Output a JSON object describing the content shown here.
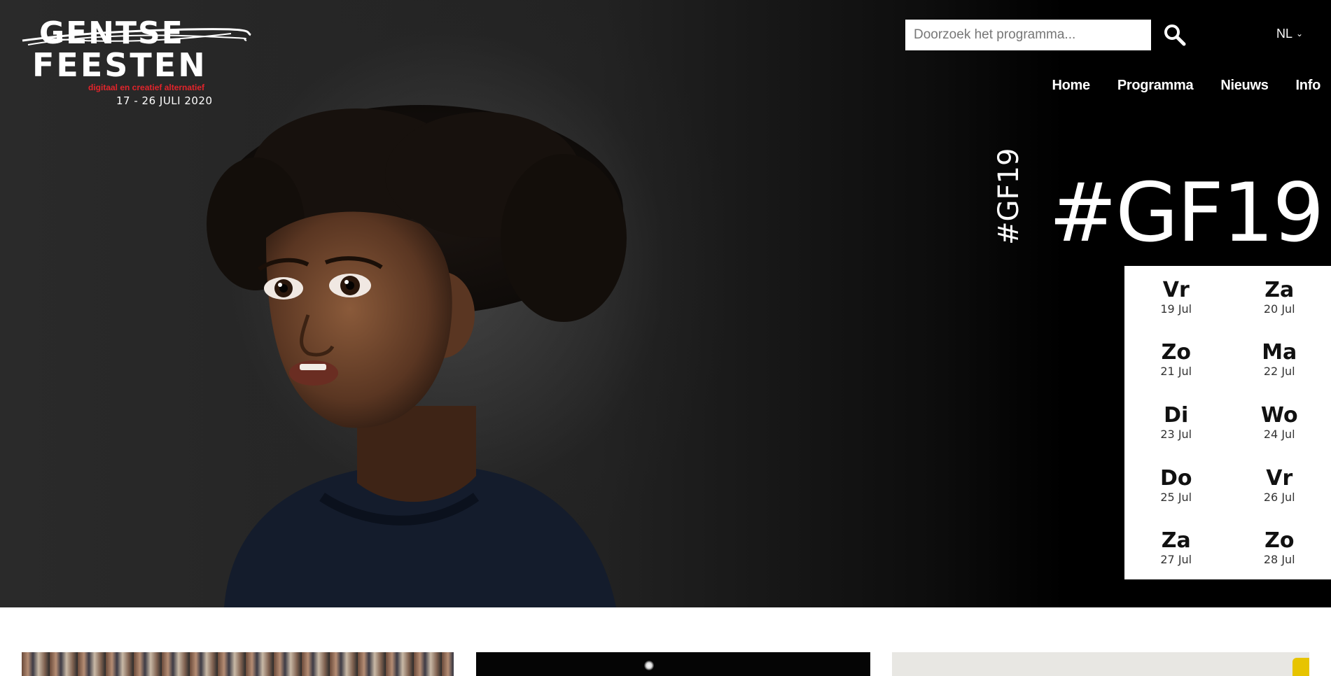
{
  "logo": {
    "line1": "GENTSE",
    "line2": "FEESTEN",
    "tagline": "digitaal en creatief alternatief",
    "dates": "17 - 26 JULI 2020"
  },
  "search": {
    "placeholder": "Doorzoek het programma...",
    "value": ""
  },
  "language": {
    "current": "NL"
  },
  "nav": {
    "items": [
      "Home",
      "Programma",
      "Nieuws",
      "Info"
    ]
  },
  "hashtag": {
    "vertical": "#GF19",
    "big": "#GF19"
  },
  "calendar": {
    "days": [
      {
        "name": "Vr",
        "date": "19 Jul"
      },
      {
        "name": "Za",
        "date": "20 Jul"
      },
      {
        "name": "Zo",
        "date": "21 Jul"
      },
      {
        "name": "Ma",
        "date": "22 Jul"
      },
      {
        "name": "Di",
        "date": "23 Jul"
      },
      {
        "name": "Wo",
        "date": "24 Jul"
      },
      {
        "name": "Do",
        "date": "25 Jul"
      },
      {
        "name": "Vr",
        "date": "26 Jul"
      },
      {
        "name": "Za",
        "date": "27 Jul"
      },
      {
        "name": "Zo",
        "date": "28 Jul"
      }
    ]
  },
  "colors": {
    "hero_background": "#000000",
    "tagline": "#e1242b",
    "calendar_background": "#ffffff",
    "text_on_dark": "#ffffff"
  },
  "icons": {
    "search": "search-icon",
    "language_dropdown": "chevron-down-icon"
  }
}
